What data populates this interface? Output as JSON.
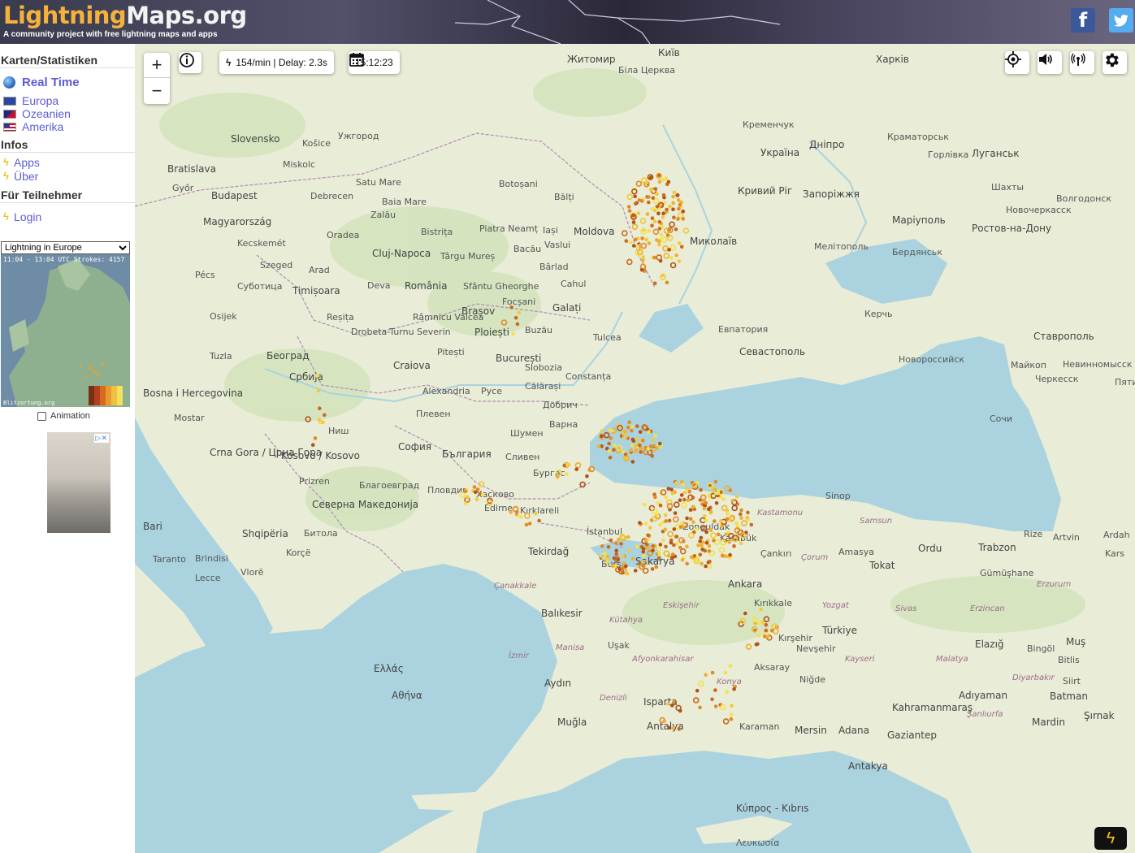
{
  "header": {
    "logo_part1": "Lightning",
    "logo_part2": "Maps.org",
    "tagline": "A community project with free lightning maps and apps",
    "facebook": "f",
    "twitter": "t"
  },
  "sidebar": {
    "section_maps": "Karten/Statistiken",
    "realtime": "Real Time",
    "regions": [
      "Europa",
      "Ozeanien",
      "Amerika"
    ],
    "section_infos": "Infos",
    "infos": [
      "Apps",
      "Über"
    ],
    "section_participants": "Für Teilnehmer",
    "login": "Login",
    "map_select": "Lightning in Europe",
    "minimap_caption": "11:04 - 13:04 UTC Strokes: 4157",
    "minimap_credit": "Blitzortung.org",
    "animation_label": "Animation"
  },
  "map": {
    "rate": "154/min | Delay: 2.3s",
    "time": "15:12:23",
    "zoom_in": "+",
    "zoom_out": "−",
    "colors": {
      "land": "#e9ecd6",
      "sea": "#aad3df",
      "stroke_recent": "#f5d43b",
      "stroke_old": "#b55a1a"
    },
    "labels": {
      "Kyiv": "Київ",
      "Zhytomyr": "Житомир",
      "Kharkiv": "Харків",
      "BilaTserkva": "Біла Церква",
      "Kremenchuk": "Кременчук",
      "Dnipro": "Дніпро",
      "Ukraine": "Україна",
      "KryvyiRih": "Кривий Ріг",
      "Zaporizhzhia": "Запоріжжя",
      "Mariupol": "Маріуполь",
      "Mykolaiv": "Миколаїв",
      "Luhansk": "Луганськ",
      "Rostov": "Ростов-на-Дону",
      "Melitopol": "Мелітополь",
      "Berdiansk": "Бердянськ",
      "Kramatorsk": "Краматорськ",
      "Horlivka": "Горлівка",
      "Shakhty": "Шахты",
      "Volgodonsk": "Волгодонск",
      "Novocherkassk": "Новочеркасск",
      "Kerch": "Керчь",
      "Stavropol": "Ставрополь",
      "Sevastopol": "Севастополь",
      "Yevpatoria": "Евпатория",
      "Novorossiysk": "Новороссийск",
      "Maikop": "Майкоп",
      "Cherkessk": "Черкесск",
      "Nevinnomyssk": "Невинномысск",
      "Sochi": "Сочи",
      "Pyatigorsk": "Пятигор",
      "Slovensko": "Slovensko",
      "Kosice": "Košice",
      "Uzhhorod": "Ужгород",
      "Bratislava": "Bratislava",
      "Miskolc": "Miskolc",
      "Budapest": "Budapest",
      "Debrecen": "Debrecen",
      "Magyarorszag": "Magyarország",
      "Kecskemet": "Kecskemét",
      "Szeged": "Szeged",
      "Pecs": "Pécs",
      "Gyor": "Győr",
      "SatuMare": "Satu Mare",
      "BaiaMare": "Baia Mare",
      "Botosani": "Botoșani",
      "Balti": "Bălți",
      "Iasi": "Iași",
      "Moldova": "Moldova",
      "Oradea": "Oradea",
      "Zalau": "Zalău",
      "Bistrita": "Bistrița",
      "PiatraNeamt": "Piatra Neamț",
      "Bacau": "Bacău",
      "Vaslui": "Vaslui",
      "ClujNapoca": "Cluj-Napoca",
      "TarguMures": "Târgu Mureș",
      "Barlad": "Bârlad",
      "Cahul": "Cahul",
      "Arad": "Arad",
      "Timisoara": "Timișoara",
      "Deva": "Deva",
      "Romania": "România",
      "SfantuGheorghe": "Sfântu Gheorghe",
      "Brasov": "Brașov",
      "Focsani": "Focșani",
      "Galati": "Galați",
      "Subotica": "Суботица",
      "Osijek": "Osijek",
      "Resita": "Reșița",
      "RamnicuValcea": "Râmnicu Vâlcea",
      "Ploiesti": "Ploiești",
      "Buzau": "Buzău",
      "Tulcea": "Tulcea",
      "DrobetaTurnuSeverin": "Drobeta-Turnu Severin",
      "Pitesti": "Pitești",
      "Bucuresti": "București",
      "Beograd": "Београд",
      "Tuzla": "Tuzla",
      "Craiova": "Craiova",
      "Slobozia": "Slobozia",
      "Constanta": "Constanța",
      "Calarasi": "Călărași",
      "Srbija": "Србија",
      "Alexandria": "Alexandria",
      "Ruse": "Русе",
      "Dobrich": "Добрич",
      "BosnaIHercegovina": "Bosna i Hercegovina",
      "Pleven": "Плевен",
      "Varna": "Варна",
      "Shumen": "Шумен",
      "Mostar": "Mostar",
      "Nis": "Ниш",
      "Sofia": "София",
      "Balgaria": "България",
      "Sliven": "Сливен",
      "CrnaGora": "Crna Gora / Црна Гора",
      "Kosovo": "Kosovo / Kosovo",
      "Burgas": "Бургас",
      "Prizren": "Prizren",
      "Blagoevgrad": "Благоевград",
      "Plovdiv": "Пловдив",
      "Haskovo": "Хасково",
      "Edirne": "Edirne",
      "Kirklareli": "Kırklareli",
      "SevernaMakedonija": "Северна Македонија",
      "Bari": "Bari",
      "Shqiperia": "Shqipëria",
      "Bitola": "Битола",
      "Korce": "Korçë",
      "Taranto": "Taranto",
      "Brindisi": "Brindisi",
      "Lecce": "Lecce",
      "Vlore": "Vlorë",
      "Tekirdag": "Tekirdağ",
      "Istanbul": "İstanbul",
      "Sakarya": "Sakarya",
      "Zonguldak": "Zonguldak",
      "Karabuk": "Karabük",
      "Kastamonu": "Kastamonu",
      "Sinop": "Sinop",
      "Samsun": "Samsun",
      "Amasya": "Amasya",
      "Tokat": "Tokat",
      "Ordu": "Ordu",
      "Trabzon": "Trabzon",
      "Rize": "Rize",
      "Artvin": "Artvin",
      "Ardahan": "Ardah",
      "Kars": "Kars",
      "Gumushane": "Gümüşhane",
      "Erzurum": "Erzurum",
      "Canakkale": "Çanakkale",
      "Balikesir": "Balıkesir",
      "Bursa": "Bursa",
      "Eskisehir": "Eskişehir",
      "Ankara": "Ankara",
      "Kirikkale": "Kırıkkale",
      "Corum": "Çorum",
      "Cankiri": "Çankırı",
      "Yozgat": "Yozgat",
      "Sivas": "Sivas",
      "Erzincan": "Erzincan",
      "Turkiye": "Türkiye",
      "Elazig": "Elazığ",
      "Bingol": "Bingöl",
      "Mus": "Muş",
      "Kirsehir": "Kırşehir",
      "Nevsehir": "Nevşehir",
      "Kutahya": "Kütahya",
      "Usak": "Uşak",
      "Izmir": "İzmir",
      "Manisa": "Manisa",
      "Afyonkarahisar": "Afyonkarahisar",
      "Aksaray": "Aksaray",
      "Kayseri": "Kayseri",
      "Malatya": "Malatya",
      "Bitlis": "Bitlis",
      "Diyarbakir": "Diyarbakır",
      "Siirt": "Siirt",
      "Batman": "Batman",
      "Adiyaman": "Adıyaman",
      "Nigde": "Niğde",
      "Konya": "Konya",
      "Kahramanmaras": "Kahramanmaraş",
      "Sanliurfa": "Şanlıurfa",
      "Mardin": "Mardin",
      "Sirnak": "Şırnak",
      "Aydin": "Aydın",
      "Denizli": "Denizli",
      "Isparta": "Isparta",
      "Mugla": "Muğla",
      "Antalya": "Antalya",
      "Karaman": "Karaman",
      "Mersin": "Mersin",
      "Adana": "Adana",
      "Gaziantep": "Gaziantep",
      "Antakya": "Antakya",
      "Ellada": "Ελλάς",
      "Athina": "Αθήνα",
      "Kypros": "Κύπρος - Kıbrıs",
      "Lefkosia": "Λευκωσία"
    }
  }
}
